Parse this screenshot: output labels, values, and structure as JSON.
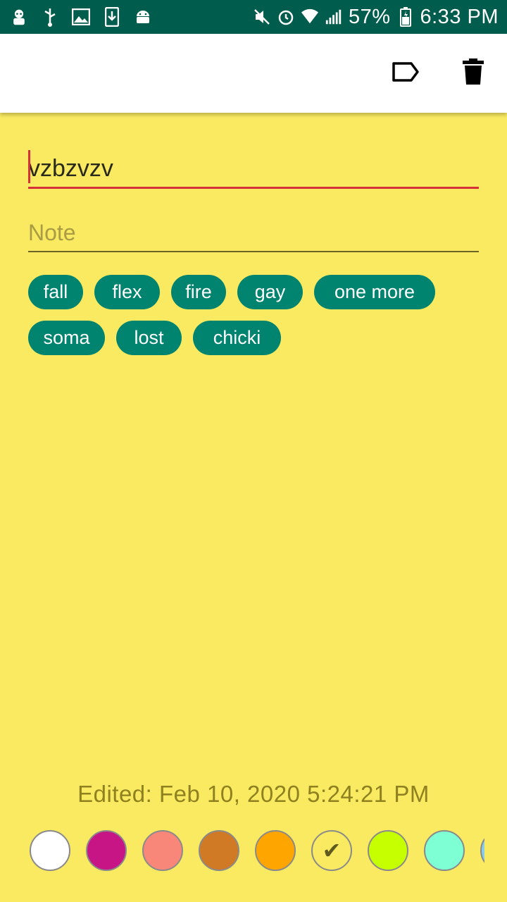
{
  "status_bar": {
    "battery": "57%",
    "time": "6:33 PM",
    "left_icons": [
      "chef-icon",
      "usb-icon",
      "image-icon",
      "download-icon",
      "android-icon"
    ],
    "right_icons": [
      "mute-icon",
      "alarm-icon",
      "wifi-icon",
      "signal-icon",
      "battery-icon"
    ]
  },
  "toolbar": {
    "actions": [
      "label-icon",
      "delete-icon"
    ]
  },
  "note": {
    "title": "vzbzvzv",
    "body_placeholder": "Note",
    "tags": [
      "fall",
      "flex",
      "fire",
      "gay",
      "one more",
      "soma",
      "lost",
      "chicki"
    ]
  },
  "edited": "Edited: Feb 10, 2020 5:24:21 PM",
  "colors": {
    "background": "#f9ea61",
    "accent": "#d6313b",
    "tag": "#00836f",
    "status_bar": "#005c4c",
    "swatches": [
      "#ffffff",
      "#c71585",
      "#f8877a",
      "#d07a26",
      "#ffa500",
      "#f9ea61",
      "#c6ff00",
      "#7fffd4",
      "#87ceeb"
    ],
    "selected_swatch": "#f9ea61"
  }
}
